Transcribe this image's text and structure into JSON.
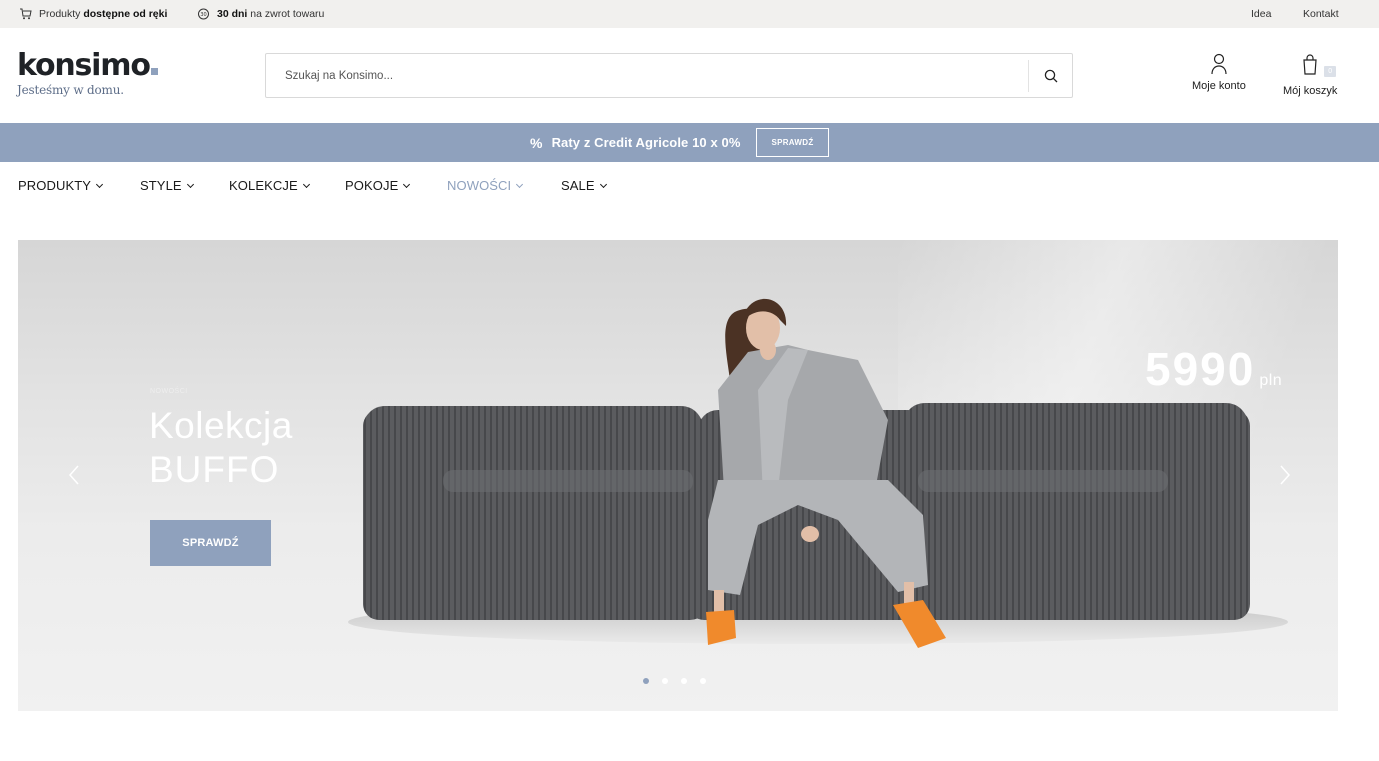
{
  "topbar": {
    "delivery_prefix": "Produkty",
    "delivery_bold": "dostępne od ręki",
    "return_bold": "30 dni",
    "return_rest": "na zwrot towaru",
    "link_idea": "Idea",
    "link_contact": "Kontakt"
  },
  "logo": {
    "name": "konsimo",
    "tagline": "Jesteśmy w domu."
  },
  "search": {
    "placeholder": "Szukaj na Konsimo..."
  },
  "account": {
    "label": "Moje konto"
  },
  "cart": {
    "label": "Mój koszyk",
    "count": "0"
  },
  "promo": {
    "icon": "%",
    "text": "Raty z Credit Agricole 10 x 0%",
    "button": "SPRAWDŹ"
  },
  "nav": {
    "items": [
      {
        "label": "PRODUKTY"
      },
      {
        "label": "STYLE"
      },
      {
        "label": "KOLEKCJE"
      },
      {
        "label": "POKOJE"
      },
      {
        "label": "NOWOŚCI"
      },
      {
        "label": "SALE"
      }
    ]
  },
  "hero": {
    "tag": "NOWOŚCI",
    "title_line1": "Kolekcja",
    "title_line2": "BUFFO",
    "button": "SPRAWDŹ",
    "price": "5990",
    "currency": "pln",
    "slides": 4,
    "active_slide": 1
  },
  "colors": {
    "accent": "#8fa1bd",
    "topbar_bg": "#f1f0ee",
    "text": "#1a1a1a"
  }
}
